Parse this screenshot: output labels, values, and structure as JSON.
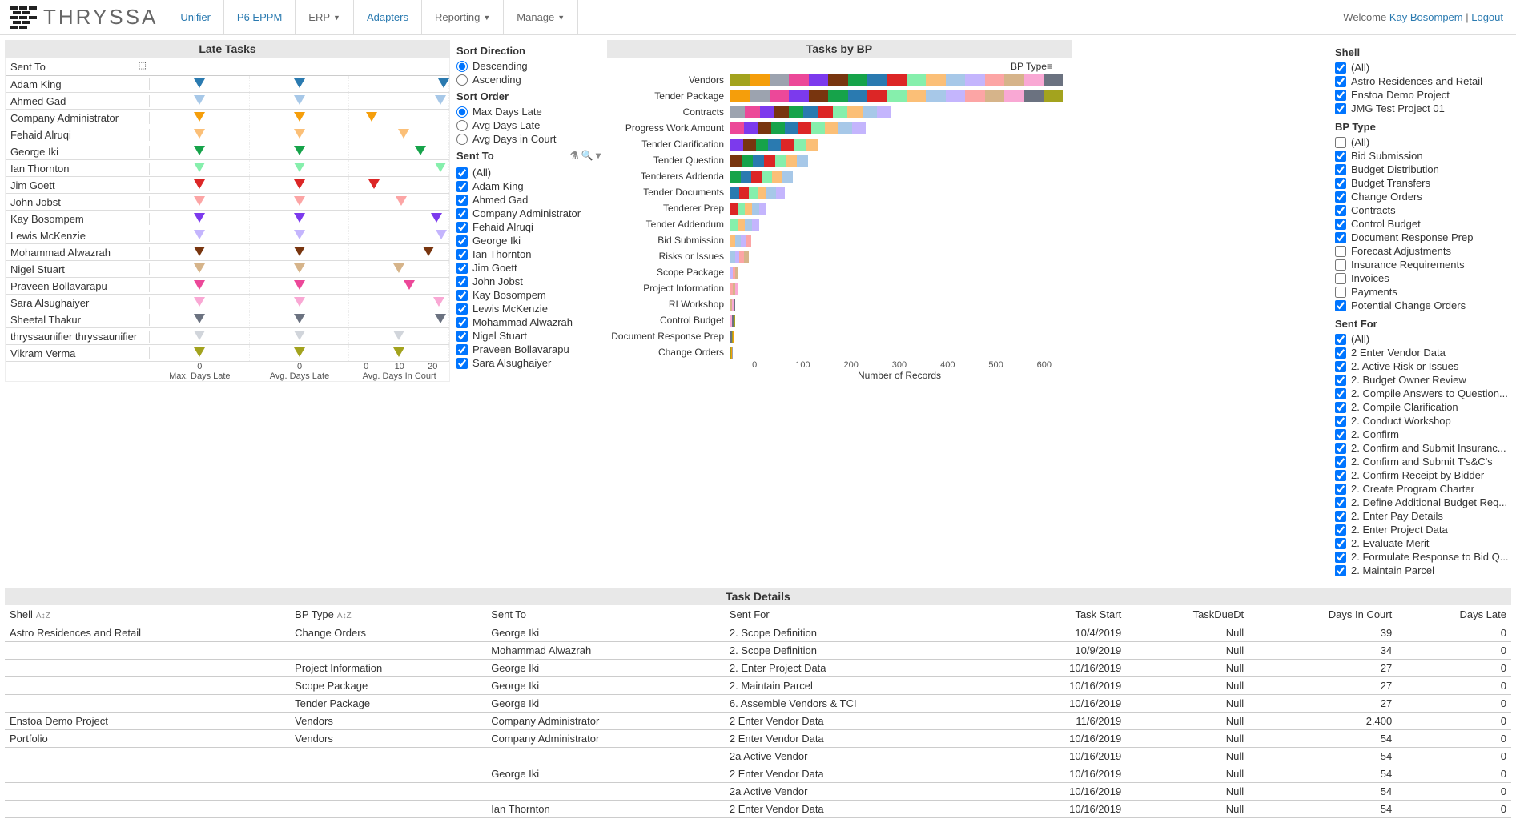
{
  "brand": "THRYSSA",
  "nav": [
    {
      "label": "Unifier",
      "link": true
    },
    {
      "label": "P6 EPPM",
      "link": true
    },
    {
      "label": "ERP",
      "caret": true
    },
    {
      "label": "Adapters",
      "link": true
    },
    {
      "label": "Reporting",
      "caret": true
    },
    {
      "label": "Manage",
      "caret": true
    }
  ],
  "welcome": {
    "prefix": "Welcome ",
    "user": "Kay Bosompem",
    "sep": " | ",
    "logout": "Logout"
  },
  "lateTasks": {
    "title": "Late Tasks",
    "header": "Sent To",
    "axisLabels": [
      "Max. Days Late",
      "Avg. Days Late",
      "Avg. Days In Court"
    ],
    "axisTicks": [
      [
        "0"
      ],
      [
        "0"
      ],
      [
        "0",
        "10",
        "20"
      ]
    ],
    "rows": [
      {
        "name": "Adam King",
        "color": "#2a7ab0",
        "pos": [
          50,
          50,
          95
        ]
      },
      {
        "name": "Ahmed Gad",
        "color": "#a7c8e8",
        "pos": [
          50,
          50,
          92
        ]
      },
      {
        "name": "Company Administrator",
        "color": "#f59e0b",
        "pos": [
          50,
          50,
          22
        ]
      },
      {
        "name": "Fehaid Alruqi",
        "color": "#fbbf77",
        "pos": [
          50,
          50,
          55
        ]
      },
      {
        "name": "George Iki",
        "color": "#16a34a",
        "pos": [
          50,
          50,
          72
        ]
      },
      {
        "name": "Ian Thornton",
        "color": "#86efac",
        "pos": [
          50,
          50,
          92
        ]
      },
      {
        "name": "Jim Goett",
        "color": "#dc2626",
        "pos": [
          50,
          50,
          25
        ]
      },
      {
        "name": "John Jobst",
        "color": "#fca5a5",
        "pos": [
          50,
          50,
          52
        ]
      },
      {
        "name": "Kay Bosompem",
        "color": "#7c3aed",
        "pos": [
          50,
          50,
          88
        ]
      },
      {
        "name": "Lewis McKenzie",
        "color": "#c4b5fd",
        "pos": [
          50,
          50,
          93
        ]
      },
      {
        "name": "Mohammad Alwazrah",
        "color": "#78350f",
        "pos": [
          50,
          50,
          80
        ]
      },
      {
        "name": "Nigel Stuart",
        "color": "#d6b48a",
        "pos": [
          50,
          50,
          50
        ]
      },
      {
        "name": "Praveen Bollavarapu",
        "color": "#ec4899",
        "pos": [
          50,
          50,
          60
        ]
      },
      {
        "name": "Sara Alsughaiyer",
        "color": "#f9a8d4",
        "pos": [
          50,
          50,
          90
        ]
      },
      {
        "name": "Sheetal Thakur",
        "color": "#6b7280",
        "pos": [
          50,
          50,
          92
        ]
      },
      {
        "name": "thryssaunifier thryssaunifier",
        "color": "#d1d5db",
        "pos": [
          50,
          50,
          50
        ]
      },
      {
        "name": "Vikram Verma",
        "color": "#a3a31e",
        "pos": [
          50,
          50,
          50
        ]
      }
    ]
  },
  "sortDirection": {
    "label": "Sort Direction",
    "options": [
      "Descending",
      "Ascending"
    ],
    "selected": "Descending"
  },
  "sortOrder": {
    "label": "Sort Order",
    "options": [
      "Max Days Late",
      "Avg Days Late",
      "Avg Days in Court"
    ],
    "selected": "Max Days Late"
  },
  "sentToFilter": {
    "label": "Sent To",
    "items": [
      "(All)",
      "Adam King",
      "Ahmed Gad",
      "Company Administrator",
      "Fehaid Alruqi",
      "George Iki",
      "Ian Thornton",
      "Jim Goett",
      "John Jobst",
      "Kay Bosompem",
      "Lewis McKenzie",
      "Mohammad Alwazrah",
      "Nigel Stuart",
      "Praveen Bollavarapu",
      "Sara Alsughaiyer"
    ]
  },
  "tasksByBP": {
    "title": "Tasks by BP",
    "headerLabel": "BP Type",
    "xLabel": "Number of Records",
    "xTicks": [
      "0",
      "100",
      "200",
      "300",
      "400",
      "500",
      "600"
    ]
  },
  "chart_data": {
    "type": "bar",
    "title": "Tasks by BP",
    "xlabel": "Number of Records",
    "ylabel": "BP Type",
    "xlim": [
      0,
      650
    ],
    "categories": [
      "Vendors",
      "Tender Package",
      "Contracts",
      "Progress Work Amount",
      "Tender Clarification",
      "Tender Question",
      "Tenderers Addenda",
      "Tender Documents",
      "Tenderer Prep",
      "Tender Addendum",
      "Bid Submission",
      "Risks or Issues",
      "Scope Package",
      "Project Information",
      "RI Workshop",
      "Control Budget",
      "Document Response Prep",
      "Change Orders"
    ],
    "values": [
      640,
      640,
      310,
      260,
      170,
      150,
      120,
      105,
      70,
      55,
      40,
      35,
      15,
      15,
      10,
      10,
      8,
      5
    ],
    "stacked": true,
    "colors": [
      "#a3a31e",
      "#f59e0b",
      "#9ca3af",
      "#ec4899",
      "#7c3aed",
      "#78350f",
      "#16a34a",
      "#2a7ab0",
      "#dc2626",
      "#86efac",
      "#fbbf77",
      "#a7c8e8",
      "#c4b5fd",
      "#fca5a5",
      "#d6b48a",
      "#f9a8d4",
      "#6b7280"
    ]
  },
  "shellFilter": {
    "label": "Shell",
    "items": [
      {
        "label": "(All)",
        "checked": true
      },
      {
        "label": "Astro Residences and Retail",
        "checked": true
      },
      {
        "label": "Enstoa Demo Project",
        "checked": true
      },
      {
        "label": "JMG Test Project 01",
        "checked": true
      }
    ]
  },
  "bpTypeFilter": {
    "label": "BP Type",
    "items": [
      {
        "label": "(All)",
        "checked": false
      },
      {
        "label": "Bid Submission",
        "checked": true
      },
      {
        "label": "Budget Distribution",
        "checked": true
      },
      {
        "label": "Budget Transfers",
        "checked": true
      },
      {
        "label": "Change Orders",
        "checked": true
      },
      {
        "label": "Contracts",
        "checked": true
      },
      {
        "label": "Control Budget",
        "checked": true
      },
      {
        "label": "Document Response Prep",
        "checked": true
      },
      {
        "label": "Forecast Adjustments",
        "checked": false
      },
      {
        "label": "Insurance Requirements",
        "checked": false
      },
      {
        "label": "Invoices",
        "checked": false
      },
      {
        "label": "Payments",
        "checked": false
      },
      {
        "label": "Potential Change Orders",
        "checked": true
      }
    ]
  },
  "sentForFilter": {
    "label": "Sent For",
    "items": [
      {
        "label": "(All)",
        "checked": true
      },
      {
        "label": "2 Enter Vendor Data",
        "checked": true
      },
      {
        "label": "2. Active Risk or Issues",
        "checked": true
      },
      {
        "label": "2. Budget Owner Review",
        "checked": true
      },
      {
        "label": "2. Compile Answers to Question...",
        "checked": true
      },
      {
        "label": "2. Compile Clarification",
        "checked": true
      },
      {
        "label": "2. Conduct Workshop",
        "checked": true
      },
      {
        "label": "2. Confirm",
        "checked": true
      },
      {
        "label": "2. Confirm and Submit Insuranc...",
        "checked": true
      },
      {
        "label": "2. Confirm and Submit T's&C's",
        "checked": true
      },
      {
        "label": "2. Confirm Receipt by Bidder",
        "checked": true
      },
      {
        "label": "2. Create Program Charter",
        "checked": true
      },
      {
        "label": "2. Define Additional Budget Req...",
        "checked": true
      },
      {
        "label": "2. Enter Pay Details",
        "checked": true
      },
      {
        "label": "2. Enter Project Data",
        "checked": true
      },
      {
        "label": "2. Evaluate Merit",
        "checked": true
      },
      {
        "label": "2. Formulate Response to Bid Q...",
        "checked": true
      },
      {
        "label": "2. Maintain Parcel",
        "checked": true
      }
    ]
  },
  "taskDetails": {
    "title": "Task Details",
    "columns": [
      "Shell",
      "BP Type",
      "Sent To",
      "Sent For",
      "Task Start",
      "TaskDueDt",
      "Days In Court",
      "Days Late"
    ],
    "rows": [
      {
        "shell": "Astro Residences and Retail",
        "bp": "Change Orders",
        "to": "George Iki",
        "for": "2. Scope Definition",
        "start": "10/4/2019",
        "due": "Null",
        "court": "39",
        "late": "0"
      },
      {
        "shell": "",
        "bp": "",
        "to": "Mohammad Alwazrah",
        "for": "2. Scope Definition",
        "start": "10/9/2019",
        "due": "Null",
        "court": "34",
        "late": "0"
      },
      {
        "shell": "",
        "bp": "Project Information",
        "to": "George Iki",
        "for": "2. Enter Project Data",
        "start": "10/16/2019",
        "due": "Null",
        "court": "27",
        "late": "0"
      },
      {
        "shell": "",
        "bp": "Scope Package",
        "to": "George Iki",
        "for": "2. Maintain Parcel",
        "start": "10/16/2019",
        "due": "Null",
        "court": "27",
        "late": "0"
      },
      {
        "shell": "",
        "bp": "Tender Package",
        "to": "George Iki",
        "for": "6. Assemble Vendors & TCI",
        "start": "10/16/2019",
        "due": "Null",
        "court": "27",
        "late": "0"
      },
      {
        "shell": "Enstoa Demo Project",
        "bp": "Vendors",
        "to": "Company Administrator",
        "for": "2 Enter Vendor Data",
        "start": "11/6/2019",
        "due": "Null",
        "court": "2,400",
        "late": "0"
      },
      {
        "shell": "Portfolio",
        "bp": "Vendors",
        "to": "Company Administrator",
        "for": "2 Enter Vendor Data",
        "start": "10/16/2019",
        "due": "Null",
        "court": "54",
        "late": "0"
      },
      {
        "shell": "",
        "bp": "",
        "to": "",
        "for": "2a Active Vendor",
        "start": "10/16/2019",
        "due": "Null",
        "court": "54",
        "late": "0"
      },
      {
        "shell": "",
        "bp": "",
        "to": "George Iki",
        "for": "2 Enter Vendor Data",
        "start": "10/16/2019",
        "due": "Null",
        "court": "54",
        "late": "0"
      },
      {
        "shell": "",
        "bp": "",
        "to": "",
        "for": "2a Active Vendor",
        "start": "10/16/2019",
        "due": "Null",
        "court": "54",
        "late": "0"
      },
      {
        "shell": "",
        "bp": "",
        "to": "Ian Thornton",
        "for": "2 Enter Vendor Data",
        "start": "10/16/2019",
        "due": "Null",
        "court": "54",
        "late": "0"
      }
    ]
  }
}
